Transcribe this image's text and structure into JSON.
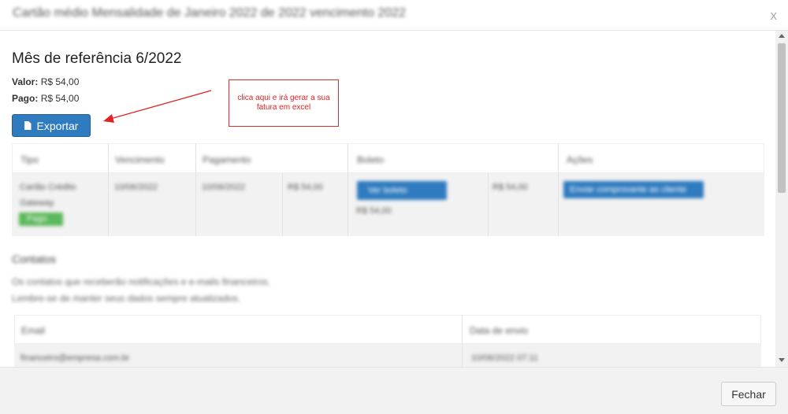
{
  "modal": {
    "header_title": "Cartão médio Mensalidade de Janeiro 2022 de 2022 vencimento 2022",
    "close_label": "x"
  },
  "reference": {
    "title": "Mês de referência 6/2022",
    "valor_label": "Valor:",
    "valor_value": "R$ 54,00",
    "pago_label": "Pago:",
    "pago_value": "R$ 54,00",
    "export_label": "Exportar"
  },
  "callout": {
    "text": "clica aqui e irá gerar a sua fatura em excel",
    "color": "#e32222"
  },
  "payments_table": {
    "headers": [
      "Tipo",
      "Vencimento",
      "Pagamento",
      "",
      "Boleto",
      "",
      "Ações"
    ],
    "row": {
      "tipo_line1": "Cartão Crédito",
      "tipo_line2": "Gateway",
      "status_badge": "Pago",
      "vencimento": "10/06/2022",
      "pagamento": "10/06/2022",
      "valor": "R$ 54,00",
      "boleto_button": "Ver boleto",
      "boleto_value": "R$ 54,00",
      "valor2": "R$ 54,00",
      "acoes_button": "Enviar comprovante ao cliente"
    }
  },
  "contacts": {
    "title": "Contatos",
    "desc_line1": "Os contatos que receberão notificações e e-mails financeiros.",
    "desc_line2": "Lembre-se de manter seus dados sempre atualizados.",
    "headers": [
      "Email",
      "Data de envio"
    ],
    "row": {
      "email": "financeiro@empresa.com.br",
      "date": "10/06/2022 07:11"
    }
  },
  "footer": {
    "close_button": "Fechar"
  },
  "colors": {
    "primary_button": "#2f7bbf",
    "success_badge": "#5cb85c",
    "callout_border": "#d9302c"
  }
}
